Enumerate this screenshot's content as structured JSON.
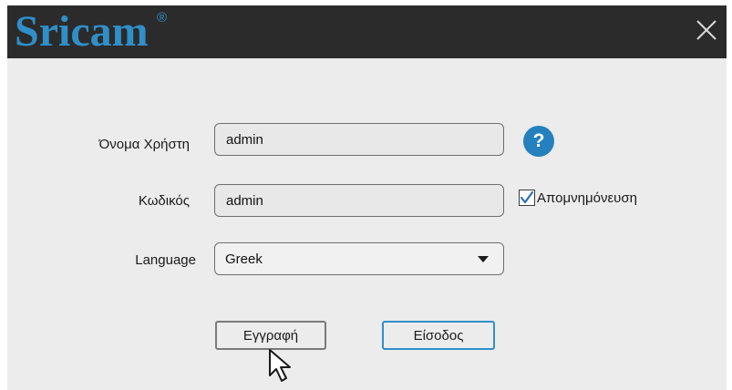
{
  "header": {
    "brand": "Sricam",
    "trademark": "®",
    "close_icon": "close-icon"
  },
  "form": {
    "username": {
      "label": "Όνομα Χρήστη",
      "value": "admin"
    },
    "password": {
      "label": "Κωδικός",
      "value": "admin"
    },
    "language": {
      "label": "Language",
      "selected": "Greek"
    },
    "remember": {
      "label": "Απομνημόνευση",
      "checked": true
    },
    "help_icon": "?"
  },
  "buttons": {
    "register": "Εγγραφή",
    "login": "Είσοδος"
  },
  "colors": {
    "brand": "#2f8fc9",
    "titlebar": "#2b2b2b",
    "background": "#ececec",
    "help": "#2481bd"
  }
}
